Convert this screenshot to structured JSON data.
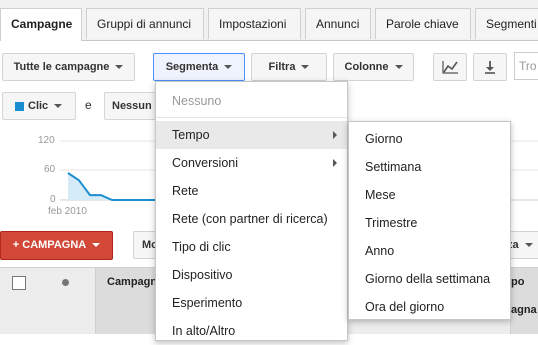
{
  "tabs": [
    "Campagne",
    "Gruppi di annunci",
    "Impostazioni",
    "Annunci",
    "Parole chiave",
    "Segmenti"
  ],
  "toolbar": {
    "all_campaigns": "Tutte le campagne",
    "segment": "Segmenta",
    "filter": "Filtra",
    "columns": "Colonne",
    "search_placeholder": "Tro"
  },
  "metrics": {
    "metric1": "Clic",
    "connector": "e",
    "metric2": "Nessun",
    "metric1_color": "#1a8ed0"
  },
  "chart": {
    "y_ticks": [
      "120",
      "60",
      "0"
    ],
    "x_label": "feb 2010",
    "values": [
      55,
      40,
      10,
      10,
      0,
      0,
      0,
      0,
      0,
      0,
      0,
      0,
      0,
      0,
      0,
      0
    ],
    "ylim": [
      0,
      120
    ]
  },
  "actions": {
    "new_campaign": "+ CAMPAGNA",
    "more": "Mo",
    "right_partial": "za"
  },
  "table": {
    "col_campaign": "Campagn",
    "col_right_a": "po",
    "col_right_b": "agna"
  },
  "segment_menu": {
    "none": "Nessuno",
    "items": [
      "Tempo",
      "Conversioni",
      "Rete",
      "Rete (con partner di ricerca)",
      "Tipo di clic",
      "Dispositivo",
      "Esperimento",
      "In alto/Altro"
    ]
  },
  "time_submenu": {
    "items": [
      "Giorno",
      "Settimana",
      "Mese",
      "Trimestre",
      "Anno",
      "Giorno della settimana",
      "Ora del giorno"
    ]
  }
}
